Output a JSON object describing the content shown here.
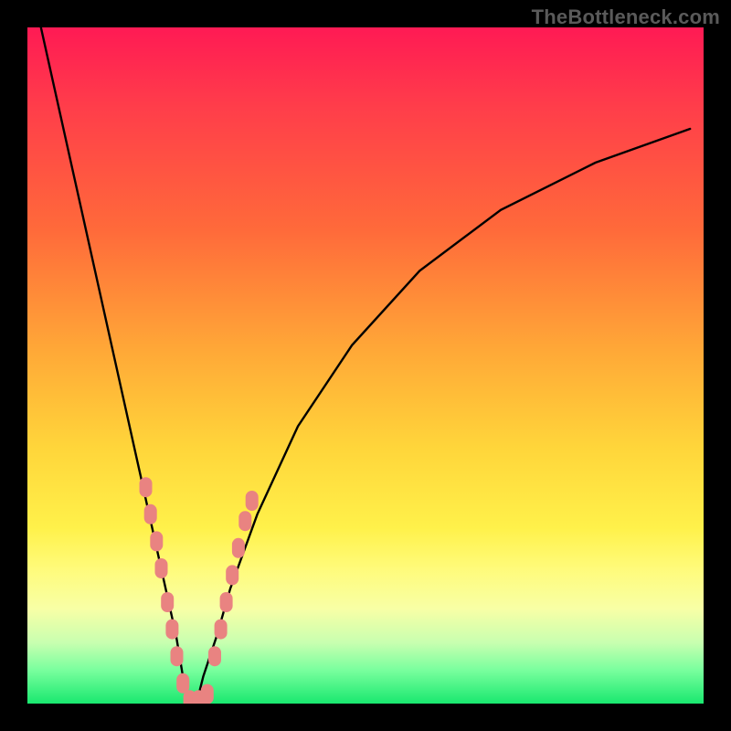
{
  "watermark": "TheBottleneck.com",
  "chart_data": {
    "type": "line",
    "title": "",
    "xlabel": "",
    "ylabel": "",
    "xlim": [
      0,
      100
    ],
    "ylim": [
      0,
      100
    ],
    "series": [
      {
        "name": "bottleneck-curve",
        "x": [
          2,
          4,
          6,
          8,
          10,
          12,
          14,
          16,
          18,
          20,
          22,
          23,
          24,
          25,
          26,
          28,
          30,
          34,
          40,
          48,
          58,
          70,
          84,
          98
        ],
        "y": [
          100,
          91,
          82,
          73,
          64,
          55,
          46,
          37,
          28,
          19,
          10,
          4,
          0,
          0,
          4,
          10,
          17,
          28,
          41,
          53,
          64,
          73,
          80,
          85
        ]
      }
    ],
    "markers": [
      {
        "name": "left-cluster",
        "points": [
          {
            "x": 17.5,
            "y": 32
          },
          {
            "x": 18.2,
            "y": 28
          },
          {
            "x": 19.1,
            "y": 24
          },
          {
            "x": 19.8,
            "y": 20
          },
          {
            "x": 20.7,
            "y": 15
          },
          {
            "x": 21.4,
            "y": 11
          },
          {
            "x": 22.1,
            "y": 7
          },
          {
            "x": 23.0,
            "y": 3
          }
        ]
      },
      {
        "name": "bottom-cluster",
        "points": [
          {
            "x": 24.0,
            "y": 0.5
          },
          {
            "x": 25.3,
            "y": 0.5
          },
          {
            "x": 26.6,
            "y": 1.4
          }
        ]
      },
      {
        "name": "right-cluster",
        "points": [
          {
            "x": 27.7,
            "y": 7
          },
          {
            "x": 28.6,
            "y": 11
          },
          {
            "x": 29.4,
            "y": 15
          },
          {
            "x": 30.3,
            "y": 19
          },
          {
            "x": 31.2,
            "y": 23
          },
          {
            "x": 32.2,
            "y": 27
          },
          {
            "x": 33.2,
            "y": 30
          }
        ]
      }
    ],
    "gradient_stops": [
      {
        "pos": 0,
        "color": "#ff1a54"
      },
      {
        "pos": 12,
        "color": "#ff3e4a"
      },
      {
        "pos": 30,
        "color": "#ff6a3a"
      },
      {
        "pos": 48,
        "color": "#ffa937"
      },
      {
        "pos": 62,
        "color": "#ffd53a"
      },
      {
        "pos": 74,
        "color": "#fff14a"
      },
      {
        "pos": 80,
        "color": "#fffb7a"
      },
      {
        "pos": 86,
        "color": "#f8ffa6"
      },
      {
        "pos": 91,
        "color": "#c8ffb0"
      },
      {
        "pos": 95,
        "color": "#7aff9e"
      },
      {
        "pos": 100,
        "color": "#19e86f"
      }
    ]
  },
  "colors": {
    "curve": "#000000",
    "marker_fill": "#e98381",
    "marker_stroke": "#e98381",
    "background": "#000000",
    "watermark": "#5a5a5a"
  }
}
